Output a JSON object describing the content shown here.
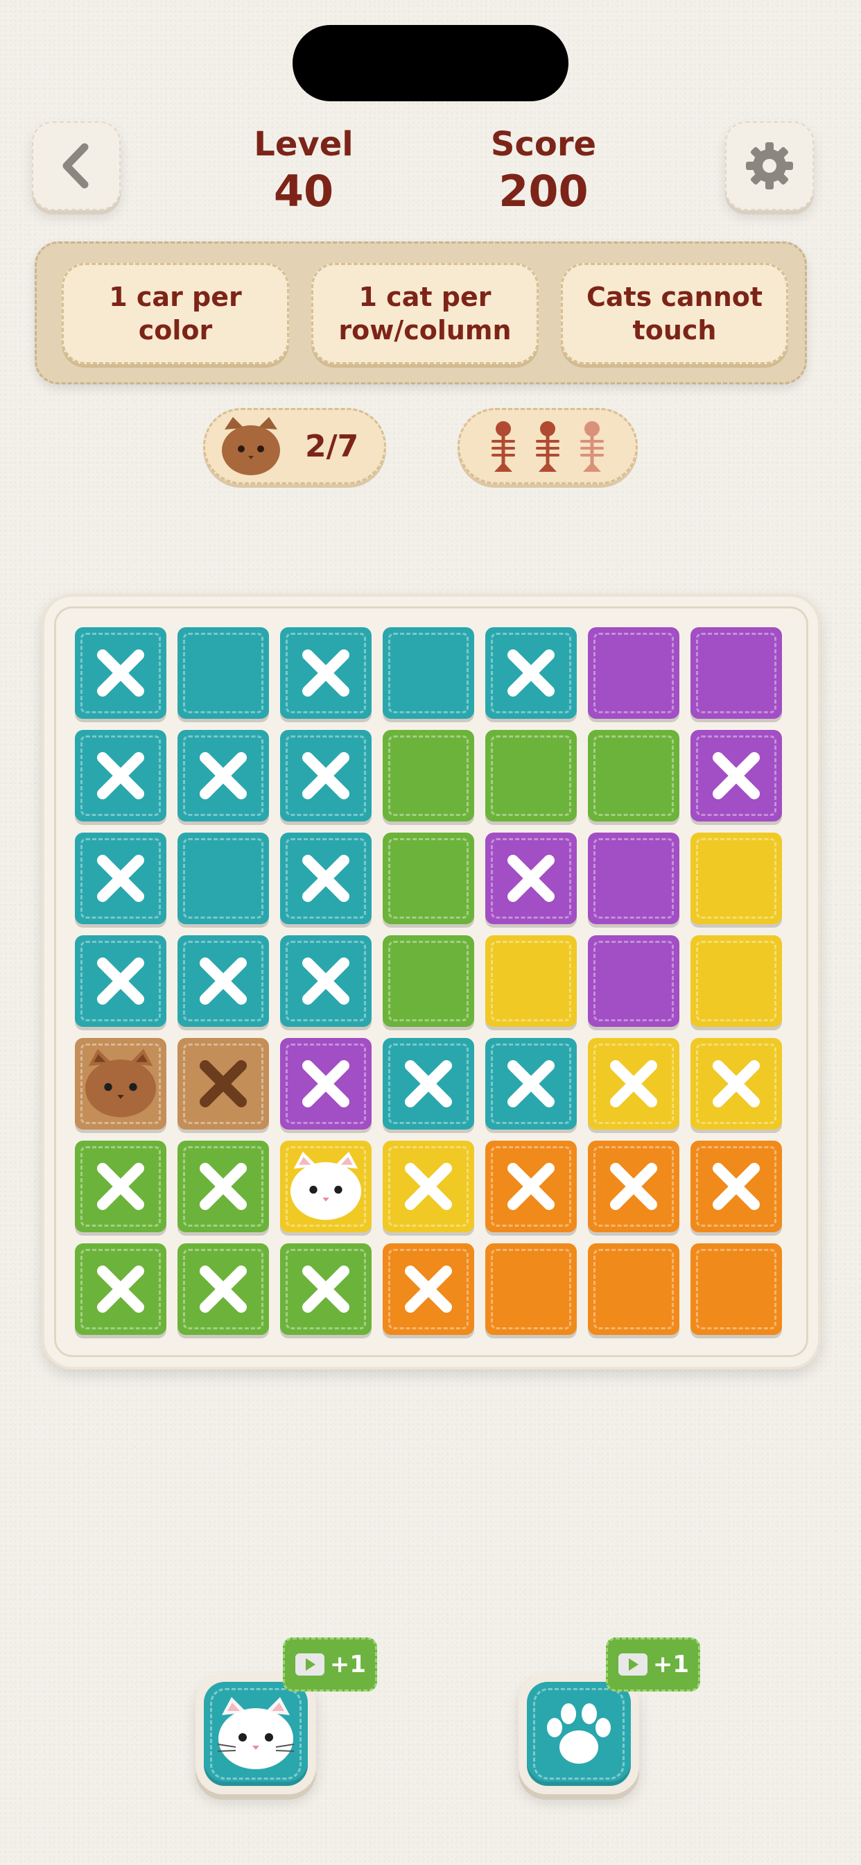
{
  "header": {
    "level_label": "Level",
    "level_value": "40",
    "score_label": "Score",
    "score_value": "200",
    "back_icon": "chevron-left-icon",
    "settings_icon": "gear-icon"
  },
  "rules": [
    {
      "text": "1 car per color"
    },
    {
      "text": "1 cat per row/column"
    },
    {
      "text": "Cats cannot touch"
    }
  ],
  "status": {
    "cat_counter": "2/7",
    "cats_placed": 2,
    "cats_total": 7,
    "lives_total": 3,
    "lives_icon": "fish-bone-icon"
  },
  "board": {
    "rows": [
      [
        {
          "c": "teal",
          "m": "x"
        },
        {
          "c": "teal",
          "m": ""
        },
        {
          "c": "teal",
          "m": "x"
        },
        {
          "c": "teal",
          "m": ""
        },
        {
          "c": "teal",
          "m": "x"
        },
        {
          "c": "purple",
          "m": ""
        },
        {
          "c": "purple",
          "m": ""
        }
      ],
      [
        {
          "c": "teal",
          "m": "x"
        },
        {
          "c": "teal",
          "m": "x"
        },
        {
          "c": "teal",
          "m": "x"
        },
        {
          "c": "green",
          "m": ""
        },
        {
          "c": "green",
          "m": ""
        },
        {
          "c": "green",
          "m": ""
        },
        {
          "c": "purple",
          "m": "x"
        }
      ],
      [
        {
          "c": "teal",
          "m": "x"
        },
        {
          "c": "teal",
          "m": ""
        },
        {
          "c": "teal",
          "m": "x"
        },
        {
          "c": "green",
          "m": ""
        },
        {
          "c": "purple",
          "m": "x"
        },
        {
          "c": "purple",
          "m": ""
        },
        {
          "c": "yellow",
          "m": ""
        }
      ],
      [
        {
          "c": "teal",
          "m": "x"
        },
        {
          "c": "teal",
          "m": "x"
        },
        {
          "c": "teal",
          "m": "x"
        },
        {
          "c": "green",
          "m": ""
        },
        {
          "c": "yellow",
          "m": ""
        },
        {
          "c": "purple",
          "m": ""
        },
        {
          "c": "yellow",
          "m": ""
        }
      ],
      [
        {
          "c": "brown",
          "m": "cat-brown"
        },
        {
          "c": "brown",
          "m": "x-dark"
        },
        {
          "c": "purple",
          "m": "x"
        },
        {
          "c": "teal",
          "m": "x"
        },
        {
          "c": "teal",
          "m": "x"
        },
        {
          "c": "yellow",
          "m": "x"
        },
        {
          "c": "yellow",
          "m": "x"
        }
      ],
      [
        {
          "c": "green",
          "m": "x"
        },
        {
          "c": "green",
          "m": "x"
        },
        {
          "c": "yellow",
          "m": "cat-white"
        },
        {
          "c": "yellow",
          "m": "x"
        },
        {
          "c": "orange",
          "m": "x"
        },
        {
          "c": "orange",
          "m": "x"
        },
        {
          "c": "orange",
          "m": "x"
        }
      ],
      [
        {
          "c": "green",
          "m": "x"
        },
        {
          "c": "green",
          "m": "x"
        },
        {
          "c": "green",
          "m": "x"
        },
        {
          "c": "orange",
          "m": "x"
        },
        {
          "c": "orange",
          "m": ""
        },
        {
          "c": "orange",
          "m": ""
        },
        {
          "c": "orange",
          "m": ""
        }
      ]
    ]
  },
  "powerups": [
    {
      "name": "cat-hint",
      "icon": "cat-face-icon",
      "badge": "+1",
      "badge_icon": "video-play-icon"
    },
    {
      "name": "paw-hint",
      "icon": "paw-icon",
      "badge": "+1",
      "badge_icon": "video-play-icon"
    }
  ],
  "colors": {
    "teal": "#2aa7ad",
    "purple": "#a24ec4",
    "green": "#6cb33b",
    "yellow": "#f0c925",
    "orange": "#f08a1b",
    "brown": "#c48e58",
    "text_dark_red": "#7d2418"
  }
}
